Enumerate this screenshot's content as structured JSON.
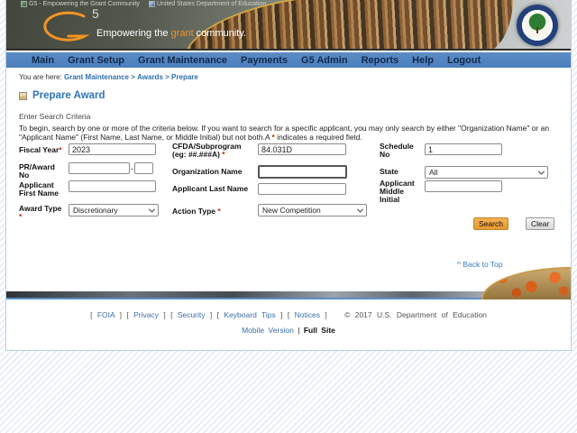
{
  "top_links": [
    {
      "label": "G5 - Empowering the Grant Community"
    },
    {
      "label": "United States Department of Education"
    }
  ],
  "header": {
    "logo_number": "5",
    "tagline_prefix": "Empowering the ",
    "tagline_highlight": "grant",
    "tagline_suffix": " community."
  },
  "nav": {
    "items": [
      "Main",
      "Grant Setup",
      "Grant Maintenance",
      "Payments",
      "G5 Admin",
      "Reports",
      "Help",
      "Logout"
    ]
  },
  "breadcrumb": {
    "prefix": "You are here:",
    "items": [
      "Grant Maintenance",
      "Awards",
      "Prepare"
    ],
    "separator": ">"
  },
  "page_title": "Prepare Award",
  "section_heading": "Enter Search Criteria",
  "instructions": {
    "text": "To begin, search by one or more of the criteria below. If you want to search for a specific applicant, you may only search by either \"Organization Name\" or an \"Applicant Name\" (First Name, Last Name, or Middle Initial) but not both.A ",
    "marker": "*",
    "suffix": " indicates a required field."
  },
  "form": {
    "fiscal_year": {
      "label": "Fiscal Year",
      "required": "*",
      "value": "2023"
    },
    "cfda": {
      "label": "CFDA/Subprogram",
      "label2": "(eg: ##.###A) ",
      "required": "*",
      "value": "84.031D"
    },
    "schedule_no": {
      "label": "Schedule No",
      "value": "1"
    },
    "pr_award_no": {
      "label": "PR/Award No",
      "value_main": "",
      "value_suffix": "",
      "separator": "-"
    },
    "organization_name": {
      "label": "Organization Name",
      "value": ""
    },
    "state": {
      "label": "State",
      "value": "All"
    },
    "applicant_first_name": {
      "label": "Applicant First Name",
      "value": ""
    },
    "applicant_last_name": {
      "label": "Applicant Last Name",
      "value": ""
    },
    "applicant_middle_initial": {
      "label": "Applicant Middle Initial",
      "value": ""
    },
    "award_type": {
      "label": "Award Type",
      "required": "*",
      "value": "Discretionary"
    },
    "action_type": {
      "label": "Action Type ",
      "required": "*",
      "value": "New Competition"
    }
  },
  "buttons": {
    "search": "Search",
    "clear": "Clear"
  },
  "back_to_top": {
    "caret": "^ ",
    "label": "Back to Top"
  },
  "footer": {
    "bracket_open": "[",
    "bracket_close": "]",
    "links": [
      "FOIA",
      "Privacy",
      "Security",
      "Keyboard Tips",
      "Notices"
    ],
    "copyright": "© 2017 U.S. Department of Education",
    "mobile_version": "Mobile Version",
    "divider": "|",
    "full_site": "Full Site"
  }
}
